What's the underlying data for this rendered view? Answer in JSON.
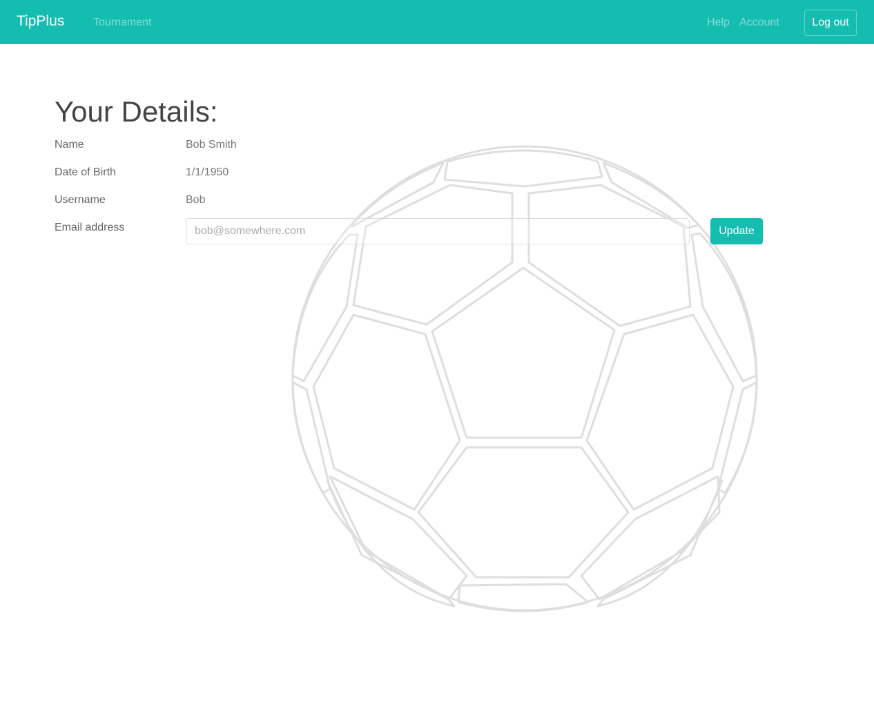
{
  "nav": {
    "brand": "TipPlus",
    "links": [
      "Tournament",
      "Help",
      "Account"
    ],
    "logout_label": "Log out",
    "color": "#15bdb1"
  },
  "page": {
    "title": "Your Details:"
  },
  "details": [
    {
      "label": "Name",
      "value": "Bob Smith"
    },
    {
      "label": "Date of Birth",
      "value": "1/1/1950"
    },
    {
      "label": "Username",
      "value": "Bob"
    }
  ],
  "email": {
    "label": "Email address",
    "placeholder": "bob@somewhere.com",
    "value": "",
    "button_label": "Update"
  },
  "background": {
    "icon": "soccer-ball-icon"
  }
}
